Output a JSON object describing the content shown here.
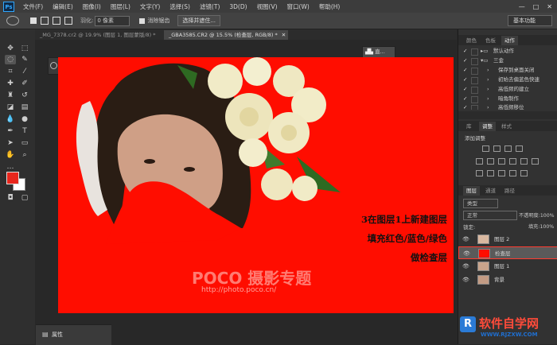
{
  "app": {
    "logo": "Ps"
  },
  "menu": [
    "文件(F)",
    "编辑(E)",
    "图像(I)",
    "图层(L)",
    "文字(Y)",
    "选择(S)",
    "滤镜(T)",
    "3D(D)",
    "视图(V)",
    "窗口(W)",
    "帮助(H)"
  ],
  "window_controls": [
    "—",
    "□",
    "✕"
  ],
  "options": {
    "feather_label": "羽化:",
    "feather_value": "0 像素",
    "antialias_label": "消除锯齿",
    "select_mask_button": "选择并遮住...",
    "workspace": "基本功能"
  },
  "doc_tabs": [
    {
      "label": "_MG_7378.cr2 @ 19.9% (图层 1, 图层蒙版/8) *",
      "close": "✕"
    },
    {
      "label": "_GBA3585.CR2 @ 15.5% (检查层, RGB/8) *",
      "close": "✕"
    }
  ],
  "float_panel": {
    "label": "直..."
  },
  "canvas": {
    "background_color": "#ff0d00",
    "annotation_lines": [
      "3在图层1上新建图层",
      "填充红色/蓝色/绿色",
      "做检查层"
    ],
    "watermark_brand": "POCO 摄影专题",
    "watermark_url": "http://photo.poco.cn/"
  },
  "properties_panel": {
    "label": "属性"
  },
  "panels": {
    "top_tabs": [
      "颜色",
      "色板",
      "动作"
    ],
    "actions": [
      {
        "label": "默认动作"
      },
      {
        "label": "三金"
      },
      {
        "label": "保存到桌面关闭"
      },
      {
        "label": "初始去偏蓝色快速"
      },
      {
        "label": "高低频的建立"
      },
      {
        "label": "暗角制作"
      },
      {
        "label": "高低频移位"
      }
    ],
    "adj_tabs": [
      "库",
      "调整",
      "样式"
    ],
    "adjust_title": "添加调整",
    "layer_tabs": [
      "图层",
      "通道",
      "路径"
    ],
    "filter_label": "类型",
    "blend_mode": "正常",
    "opacity_label": "不透明度:",
    "opacity_value": "100%",
    "lock_label": "锁定:",
    "fill_label": "填充:",
    "fill_value": "100%",
    "layers": [
      {
        "name": "图层 2",
        "thumb": "photo"
      },
      {
        "name": "检查层",
        "thumb": "red",
        "selected": true
      },
      {
        "name": "图层 1",
        "thumb": "photo"
      },
      {
        "name": "背景",
        "thumb": "photo"
      }
    ]
  },
  "site_watermark": "软件自学网",
  "site_url": "WWW.RJZXW.COM",
  "colors": {
    "foreground": "#e8261c",
    "background": "#ffffff",
    "accent": "#31a8ff"
  }
}
